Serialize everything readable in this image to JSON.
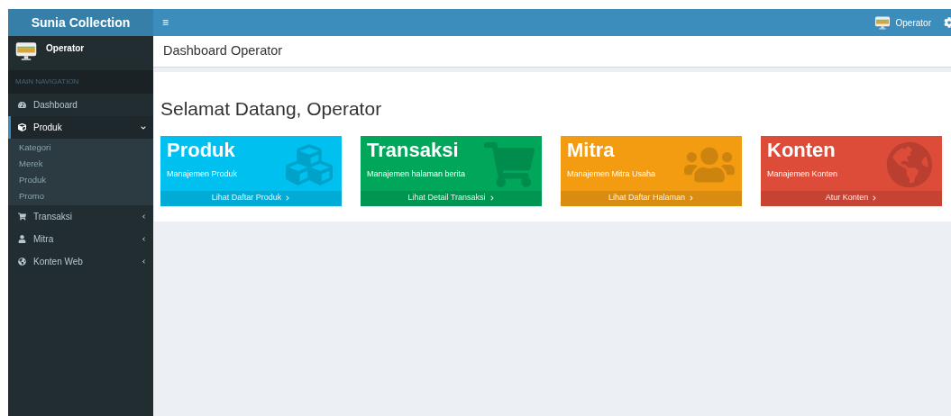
{
  "brand": "Sunia Collection",
  "navbar": {
    "menu_glyph": "≡",
    "user": "Operator"
  },
  "user_panel": {
    "name": "Operator"
  },
  "sidebar": {
    "header": "MAIN NAVIGATION",
    "items": [
      {
        "label": "Dashboard",
        "selected": false
      },
      {
        "label": "Produk",
        "selected": true,
        "expanded": true,
        "children": [
          {
            "label": "Kategori"
          },
          {
            "label": "Merek"
          },
          {
            "label": "Produk"
          },
          {
            "label": "Promo"
          }
        ]
      },
      {
        "label": "Transaksi",
        "selected": false,
        "expanded": false
      },
      {
        "label": "Mitra",
        "selected": false,
        "expanded": false
      },
      {
        "label": "Konten Web",
        "selected": false,
        "expanded": false
      }
    ]
  },
  "page_title": "Dashboard Operator",
  "welcome": "Selamat Datang, Operator",
  "cards": [
    {
      "title": "Produk",
      "subtitle": "Manajemen Produk",
      "link": "Lihat Daftar Produk",
      "color": "#00c0ef"
    },
    {
      "title": "Transaksi",
      "subtitle": "Manajemen halaman berita",
      "link": "Lihat Detail Transaksi",
      "color": "#00a65a"
    },
    {
      "title": "Mitra",
      "subtitle": "Manajemen Mitra Usaha",
      "link": "Lihat Daftar Halaman",
      "color": "#f39c12"
    },
    {
      "title": "Konten",
      "subtitle": "Manajemen Konten",
      "link": "Atur Konten",
      "color": "#dd4b39"
    }
  ]
}
